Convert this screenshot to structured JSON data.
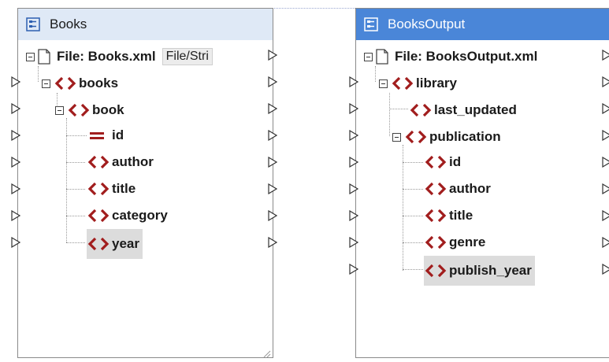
{
  "left_component": {
    "title": "Books",
    "file_label": "File: Books.xml",
    "file_button": "File/Stri",
    "nodes": {
      "books": "books",
      "book": "book",
      "id": "id",
      "author": "author",
      "title": "title",
      "category": "category",
      "year": "year"
    }
  },
  "right_component": {
    "title": "BooksOutput",
    "file_label": "File: BooksOutput.xml",
    "nodes": {
      "library": "library",
      "last_updated": "last_updated",
      "publication": "publication",
      "id": "id",
      "author": "author",
      "title": "title",
      "genre": "genre",
      "publish_year": "publish_year"
    }
  },
  "colors": {
    "element_icon": "#a11d1d",
    "right_title_bg": "#4a86d8",
    "left_title_bg": "#dfe9f6",
    "selection": "#dcdcdc"
  },
  "icons": {
    "component": "component-icon",
    "file": "file-icon",
    "element": "element-icon",
    "attribute": "attribute-icon",
    "connector": "connector-triangle-icon"
  }
}
